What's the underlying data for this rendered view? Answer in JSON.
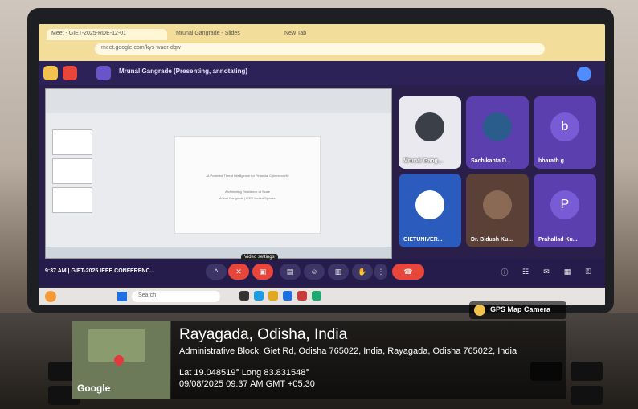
{
  "browser": {
    "tabs": [
      "Meet - GIET-2025-RDE-12-01",
      "Mrunal Gangrade - Slides",
      "New Tab"
    ],
    "url": "meet.google.com/kys-waqr-dqw"
  },
  "meet": {
    "presenter_title": "Mrunal Gangrade (Presenting, annotating)",
    "time": "9:37 AM",
    "separator": "|",
    "meeting_name": "GIET-2025 IEEE CONFERENC...",
    "tooltip": "Video settings"
  },
  "slide": {
    "title": "AI-Powered Threat Intelligence for Financial Cybersecurity",
    "line2": "Architecting Resilience at Scale",
    "line3": "Mrunal Gangrade | IEEE Invited Speaker"
  },
  "participants": [
    {
      "name": "Mrunal Gang...",
      "initial": "",
      "color": "#e9e9ef"
    },
    {
      "name": "Sachikanta D...",
      "initial": "",
      "color": "#5b3fae"
    },
    {
      "name": "bharath g",
      "initial": "b",
      "color": "#5b3fae"
    },
    {
      "name": "GIETUNIVER...",
      "initial": "",
      "color": "#2a5bbd"
    },
    {
      "name": "Dr. Bidush Ku...",
      "initial": "",
      "color": "#5a4036"
    },
    {
      "name": "Prahallad Ku...",
      "initial": "P",
      "color": "#5b3fae"
    }
  ],
  "taskbar": {
    "search": "Search"
  },
  "gps": {
    "badge": "GPS Map Camera",
    "city": "Rayagada, Odisha, India",
    "address": "Administrative Block, Giet Rd, Odisha 765022, India, Rayagada, Odisha 765022, India",
    "coords": "Lat 19.048519° Long 83.831548°",
    "datetime": "09/08/2025 09:37 AM GMT +05:30",
    "map_label": "Google"
  },
  "colors": {
    "meet_bg": "#2a1f4a",
    "end_call": "#e8463a",
    "accent": "#4f8cff"
  }
}
